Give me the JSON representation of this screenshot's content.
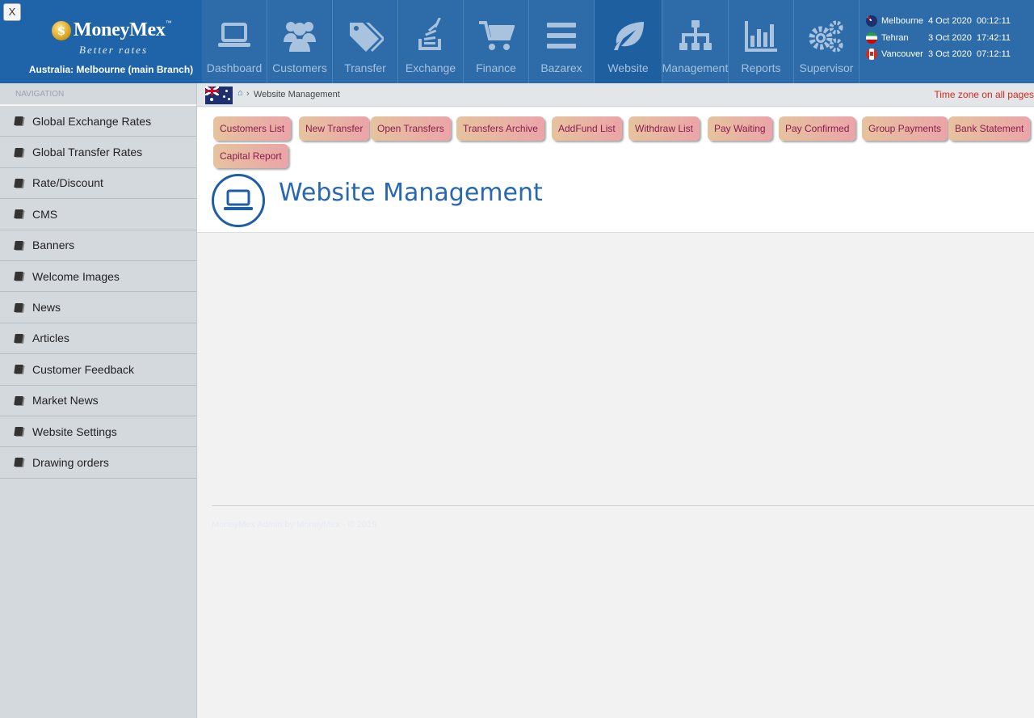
{
  "app": {
    "close_label": "X",
    "logo_name": "MoneyMex",
    "logo_tm": "™",
    "logo_coin": "$",
    "tagline": "Better rates",
    "branch": "Australia: Melbourne (main Branch)"
  },
  "nav": [
    {
      "label": "Dashboard",
      "icon": "laptop-icon"
    },
    {
      "label": "Customers",
      "icon": "users-icon"
    },
    {
      "label": "Transfer",
      "icon": "tags-icon"
    },
    {
      "label": "Exchange",
      "icon": "stack-icon"
    },
    {
      "label": "Finance",
      "icon": "cart-icon"
    },
    {
      "label": "Bazarex",
      "icon": "bars-icon"
    },
    {
      "label": "Website",
      "icon": "leaf-icon",
      "active": true
    },
    {
      "label": "Management",
      "icon": "sitemap-icon"
    },
    {
      "label": "Reports",
      "icon": "bar-chart-icon"
    },
    {
      "label": "Supervisor",
      "icon": "gears-icon"
    }
  ],
  "clocks": [
    {
      "city": "Melbourne",
      "date": "4 Oct 2020",
      "time": "00:12:11",
      "flag": "australia-flag-icon"
    },
    {
      "city": "Tehran",
      "date": "3 Oct 2020",
      "time": "17:42:11",
      "flag": "iran-flag-icon"
    },
    {
      "city": "Vancouver",
      "date": "3 Oct 2020",
      "time": "07:12:11",
      "flag": "canada-flag-icon"
    }
  ],
  "sidebar": {
    "header": "NAVIGATION",
    "items": [
      {
        "label": "Global Exchange Rates"
      },
      {
        "label": "Global Transfer Rates"
      },
      {
        "label": "Rate/Discount"
      },
      {
        "label": "CMS"
      },
      {
        "label": "Banners"
      },
      {
        "label": "Welcome Images"
      },
      {
        "label": "News"
      },
      {
        "label": "Articles"
      },
      {
        "label": "Customer Feedback"
      },
      {
        "label": "Market News"
      },
      {
        "label": "Website Settings"
      },
      {
        "label": "Drawing orders"
      }
    ]
  },
  "breadcrumb": {
    "page": "Website Management",
    "timezone_note": "Time zone on all pages"
  },
  "quick_buttons": [
    {
      "label": "Customers List"
    },
    {
      "label": "New Transfer"
    },
    {
      "label": "Open Transfers"
    },
    {
      "label": "Transfers Archive"
    },
    {
      "label": "AddFund List"
    },
    {
      "label": "Withdraw List"
    },
    {
      "label": "Pay Waiting"
    },
    {
      "label": "Pay Confirmed"
    },
    {
      "label": "Group Payments"
    },
    {
      "label": "Bank Statement"
    },
    {
      "label": "Capital Report"
    }
  ],
  "page": {
    "title": "Website Management"
  },
  "footer": {
    "text": "MoneyMex Admin by MoneyMex - © 2019"
  },
  "colors": {
    "header_bg": "#2d6ca8",
    "accent": "#2868b2",
    "button_gradient_start": "#e6c39e",
    "button_gradient_end": "#eba4a8",
    "alert": "#d32b1e"
  }
}
